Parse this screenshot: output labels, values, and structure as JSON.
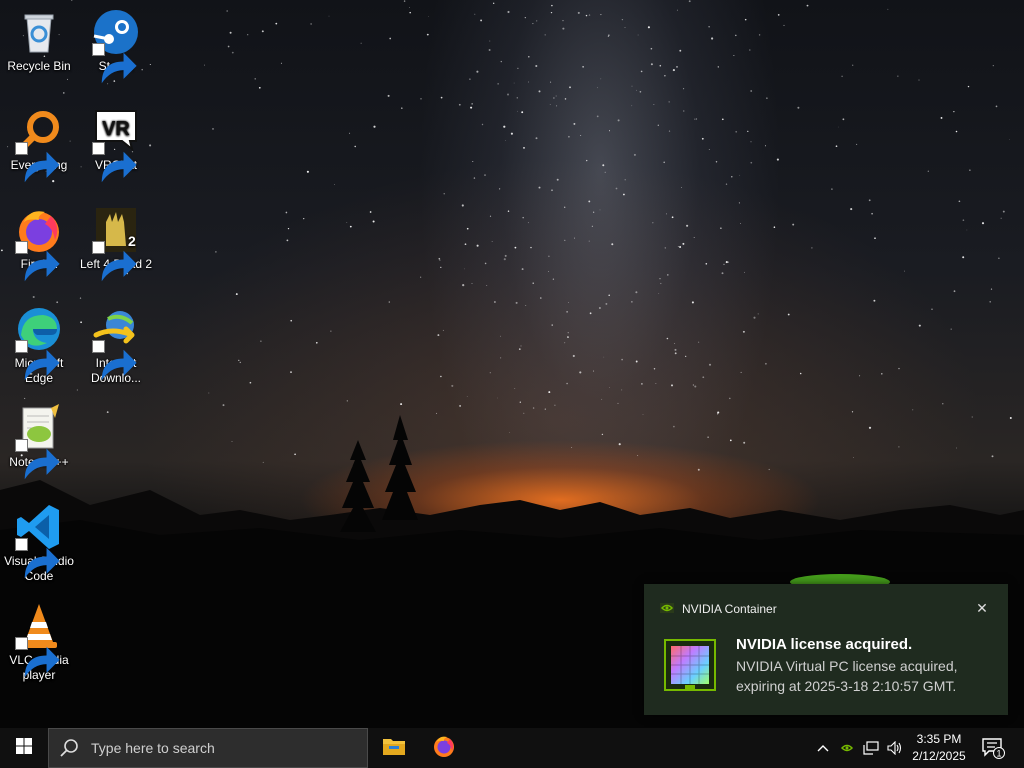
{
  "desktop": {
    "icons": [
      {
        "label": "Recycle Bin",
        "icon": "recycle-bin-icon"
      },
      {
        "label": "Steam",
        "icon": "steam-icon"
      },
      {
        "label": "Everything",
        "icon": "everything-search-icon"
      },
      {
        "label": "VRChat",
        "icon": "vrchat-icon",
        "glyph_text": "VR"
      },
      {
        "label": "Firefox",
        "icon": "firefox-icon"
      },
      {
        "label": "Left 4 Dead 2",
        "icon": "left4dead2-icon"
      },
      {
        "label": "Microsoft Edge",
        "icon": "edge-icon"
      },
      {
        "label": "Internet Downlo...",
        "icon": "internet-download-manager-icon"
      },
      {
        "label": "Notepad++",
        "icon": "notepadpp-icon"
      },
      {
        "label": "Visual Studio Code",
        "icon": "vscode-icon"
      },
      {
        "label": "VLC media player",
        "icon": "vlc-icon"
      }
    ]
  },
  "notification": {
    "app_name": "NVIDIA Container",
    "title": "NVIDIA license acquired.",
    "body": "NVIDIA Virtual PC license acquired, expiring at 2025-3-18 2:10:57 GMT.",
    "close_icon": "close-icon",
    "accent": "#76b900"
  },
  "taskbar": {
    "search_placeholder": "Type here to search",
    "clock_time": "3:35 PM",
    "clock_date": "2/12/2025",
    "notification_count": "1",
    "pinned": [
      "file-explorer-icon",
      "firefox-icon"
    ],
    "tray": [
      "chevron-up-icon",
      "nvidia-tray-icon",
      "network-icon",
      "volume-icon",
      "action-center-icon"
    ]
  }
}
